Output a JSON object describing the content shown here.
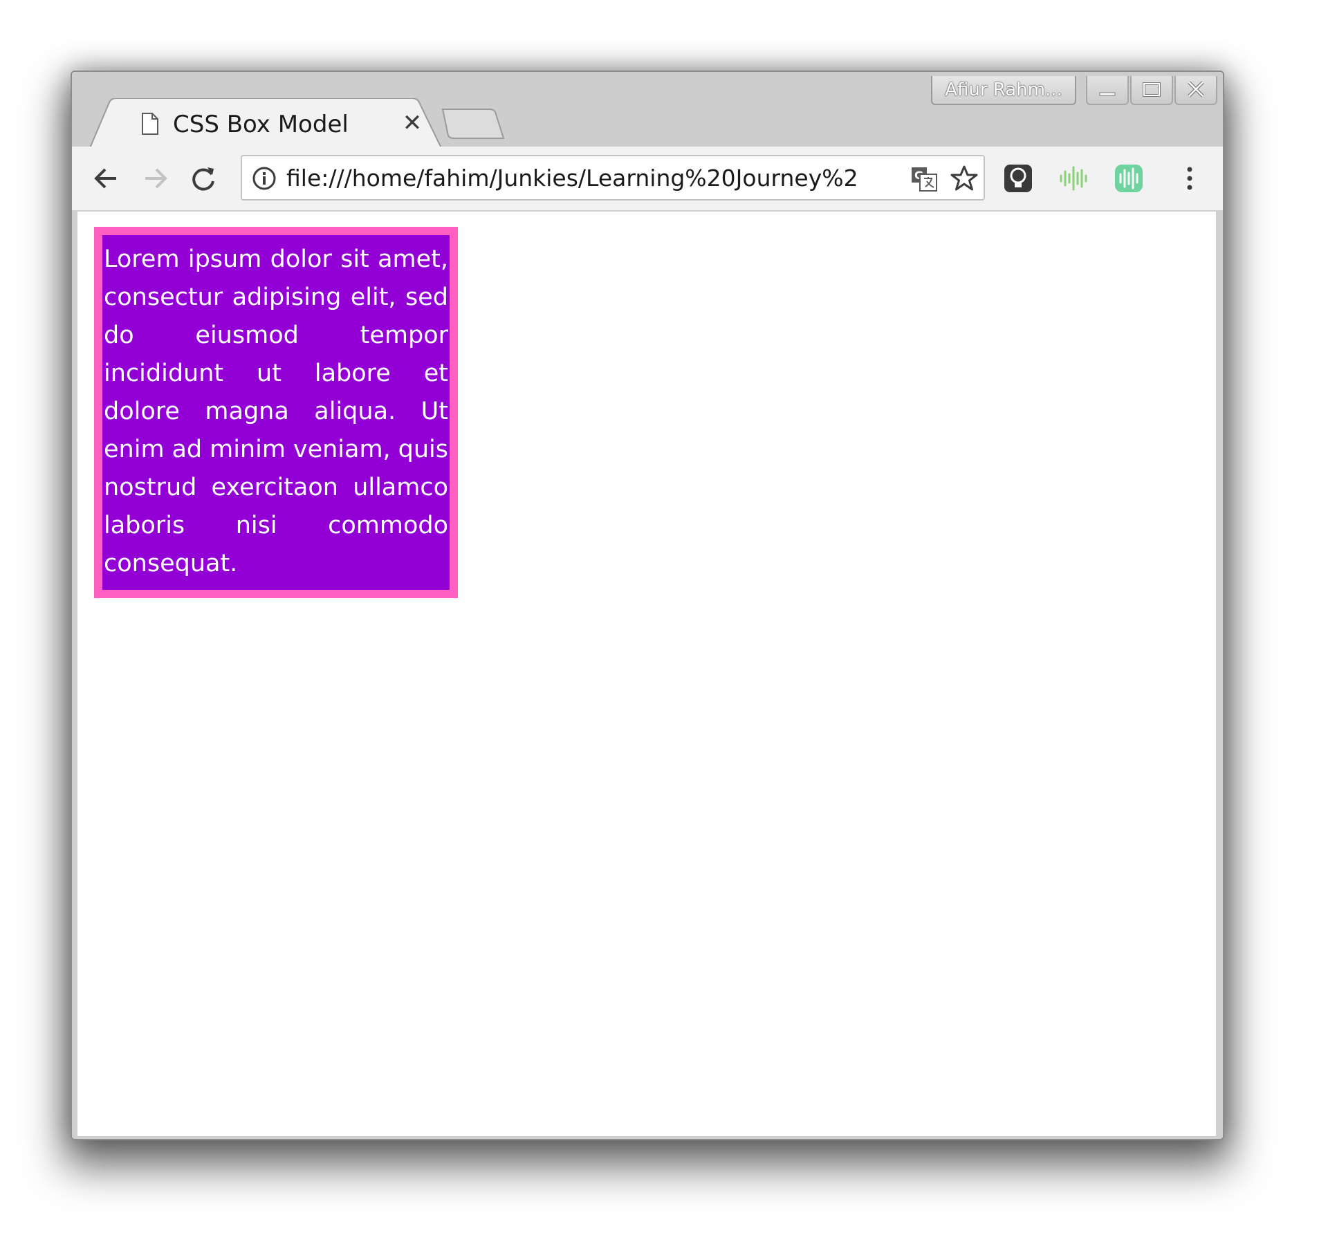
{
  "window": {
    "profile_label": "Afiur Rahm..."
  },
  "tab": {
    "title": "CSS Box Model",
    "close_glyph": "✕",
    "icon": "document-icon"
  },
  "toolbar": {
    "back_icon": "back-arrow-icon",
    "forward_icon": "forward-arrow-icon",
    "reload_icon": "reload-icon",
    "url": "file:///home/fahim/Junkies/Learning%20Journey%2",
    "info_icon": "info-icon",
    "translate_icon": "translate-icon",
    "bookmark_icon": "star-icon",
    "extensions": [
      "lightbulb-extension-icon",
      "audio-wave-extension-icon",
      "green-audio-extension-icon"
    ],
    "menu_icon": "more-vert-icon"
  },
  "content": {
    "paragraph": "Lorem ipsum dolor sit amet, consectur adipising elit, sed do eiusmod tempor incididunt ut labore et dolore magna aliqua. Ut enim ad minim veniam, quis nostrud exercitaon ullamco laboris nisi commodo consequat.",
    "box_background": "#9300d6",
    "box_border": "#ff5fc1",
    "text_color": "#ffffff"
  }
}
